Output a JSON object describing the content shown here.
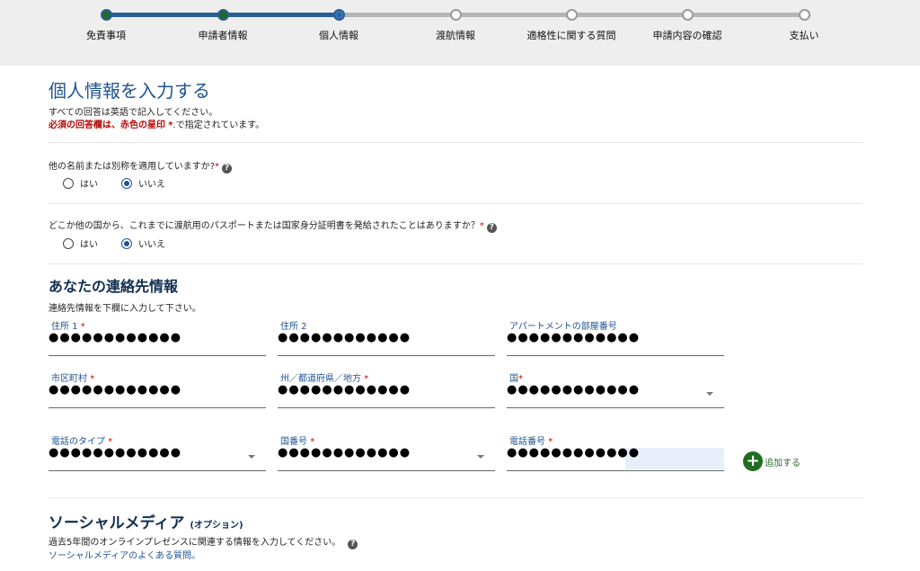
{
  "progress": {
    "steps": [
      {
        "label": "免責事項",
        "state": "done"
      },
      {
        "label": "申請者情報",
        "state": "done"
      },
      {
        "label": "個人情報",
        "state": "current"
      },
      {
        "label": "渡航情報",
        "state": "todo"
      },
      {
        "label": "適格性に関する質問",
        "state": "todo"
      },
      {
        "label": "申請内容の確認",
        "state": "todo"
      },
      {
        "label": "支払い",
        "state": "todo"
      }
    ]
  },
  "personal": {
    "title": "個人情報を入力する",
    "intro_line1": "すべての回答は英語で記入してください。",
    "required_note_bold": "必須の回答欄は、赤色の星印",
    "required_note_star": "*",
    "required_note_rest": ".で指定されています。"
  },
  "questions": [
    {
      "text": "他の名前または別称を適用していますか?",
      "options": {
        "yes": "はい",
        "no": "いいえ"
      },
      "selected": "no"
    },
    {
      "text": "どこか他の国から、これまでに渡航用のパスポートまたは国家身分証明書を発給されたことはありますか？",
      "options": {
        "yes": "はい",
        "no": "いいえ"
      },
      "selected": "no"
    }
  ],
  "contact": {
    "title": "あなたの連絡先情報",
    "intro": "連絡先情報を下欄に入力して下さい。",
    "required_star": "*",
    "fields": {
      "address1": {
        "label": "住所 1",
        "value": "●●●●●●●●●●●●",
        "required": true
      },
      "address2": {
        "label": "住所 2",
        "value": "●●●●●●●●●●●●",
        "required": false
      },
      "apartment": {
        "label": "アパートメントの部屋番号",
        "value": "●●●●●●●●●●●●",
        "required": false
      },
      "city": {
        "label": "市区町村",
        "value": "●●●●●●●●●●●●",
        "required": true
      },
      "state": {
        "label": "州／都道府県／地方",
        "value": "●●●●●●●●●●●●",
        "required": true
      },
      "country": {
        "label": "国",
        "value": "●●●●●●●●●●●●",
        "required": true
      },
      "phone_type": {
        "label": "電話のタイプ",
        "value": "●●●●●●●●●●●●",
        "required": true
      },
      "country_code": {
        "label": "国番号",
        "value": "●●●●●●●●●●●●",
        "required": true
      },
      "phone_number": {
        "label": "電話番号",
        "value": "●●●●●●●●●●●●",
        "required": true
      }
    },
    "add_label": "追加する"
  },
  "social": {
    "title": "ソーシャルメディア",
    "optional": "(オプション)",
    "intro": "過去5年間のオンラインプレゼンスに関連する情報を入力してください。",
    "faq_link": "ソーシャルメディアのよくある質問。"
  },
  "colors": {
    "accent_blue": "#205493",
    "done_green": "#1e6b2c",
    "required_red": "#b50909",
    "add_green": "#1f6c22"
  }
}
